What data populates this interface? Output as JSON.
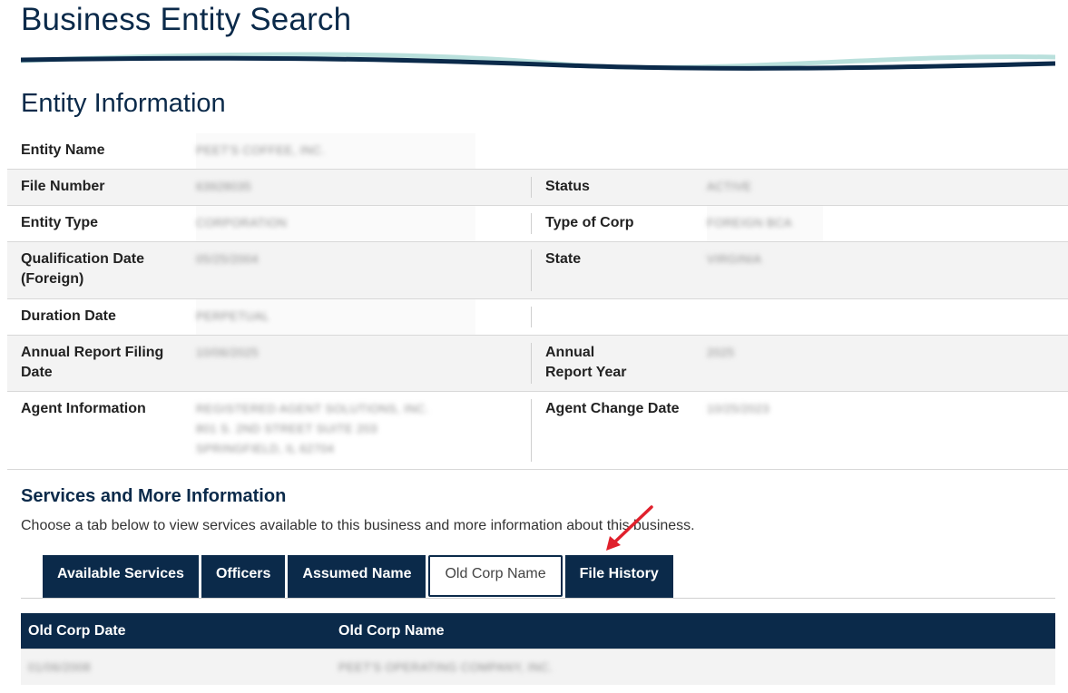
{
  "header": {
    "title": "Business Entity Search"
  },
  "entity_info": {
    "section_title": "Entity Information",
    "rows": [
      {
        "label": "Entity Name",
        "value": "PEET'S COFFEE, INC."
      },
      {
        "label": "File Number",
        "value": "63928035",
        "label2": "Status",
        "value2": "ACTIVE"
      },
      {
        "label": "Entity Type",
        "value": "CORPORATION",
        "label2": "Type of Corp",
        "value2": "FOREIGN BCA"
      },
      {
        "label": "Qualification Date (Foreign)",
        "value": "05/25/2004",
        "label2": "State",
        "value2": "VIRGINIA"
      },
      {
        "label": "Duration Date",
        "value": "PERPETUAL"
      },
      {
        "label": "Annual Report Filing Date",
        "value": "10/06/2025",
        "label2": "Annual Report Year",
        "value2": "2025"
      },
      {
        "label": "Agent Information",
        "value_lines": [
          "REGISTERED AGENT SOLUTIONS, INC.",
          "801 S. 2ND STREET SUITE 203",
          "SPRINGFIELD, IL 62704"
        ],
        "label2": "Agent Change Date",
        "value2": "10/25/2023"
      }
    ]
  },
  "services": {
    "title": "Services and More Information",
    "description": "Choose a tab below to view services available to this business and more information about this business.",
    "tabs": [
      {
        "label": "Available Services",
        "active": false
      },
      {
        "label": "Officers",
        "active": false
      },
      {
        "label": "Assumed Name",
        "active": false
      },
      {
        "label": "Old Corp Name",
        "active": true
      },
      {
        "label": "File History",
        "active": false
      }
    ]
  },
  "old_corp_table": {
    "headers": [
      "Old Corp Date",
      "Old Corp Name"
    ],
    "rows": [
      [
        "01/06/2008",
        "PEET'S OPERATING COMPANY, INC."
      ]
    ]
  },
  "colors": {
    "navy": "#0b2a4a",
    "accent_wave": "#b9e0dc",
    "arrow": "#e0202c"
  }
}
